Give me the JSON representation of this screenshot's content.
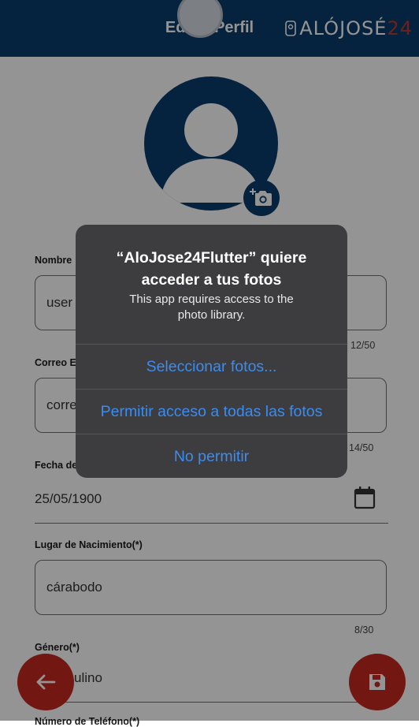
{
  "appbar": {
    "title": "Editar Perfil",
    "logo_text": "ALÓJOSÉ",
    "logo_number": "24"
  },
  "form": {
    "name_label": "Nombre",
    "name_value": "user",
    "name_counter": "12/50",
    "email_label": "Correo E",
    "email_value": "corre",
    "email_counter": "14/50",
    "birthdate_label": "Fecha de",
    "birthdate_value": "25/05/1900",
    "birthplace_label": "Lugar de Nacimiento(*)",
    "birthplace_value": "cárabodo",
    "birthplace_counter": "8/30",
    "gender_label": "Género(*)",
    "gender_value": "ulino",
    "phone_label": "Número de Teléfono(*)"
  },
  "dialog": {
    "title": "“AloJose24Flutter” quiere acceder a tus fotos",
    "message": "This app requires access to the photo library.",
    "buttons": {
      "select": "Seleccionar fotos...",
      "allow_all": "Permitir acceso a todas las fotos",
      "deny": "No permitir"
    }
  },
  "colors": {
    "primary": "#0a3d6b",
    "accent": "#c4281f",
    "ios_blue": "#3b8cf0"
  },
  "icons": {
    "back": "arrow-left-icon",
    "save": "floppy-disk-icon",
    "camera": "add-camera-icon",
    "calendar": "calendar-icon"
  }
}
